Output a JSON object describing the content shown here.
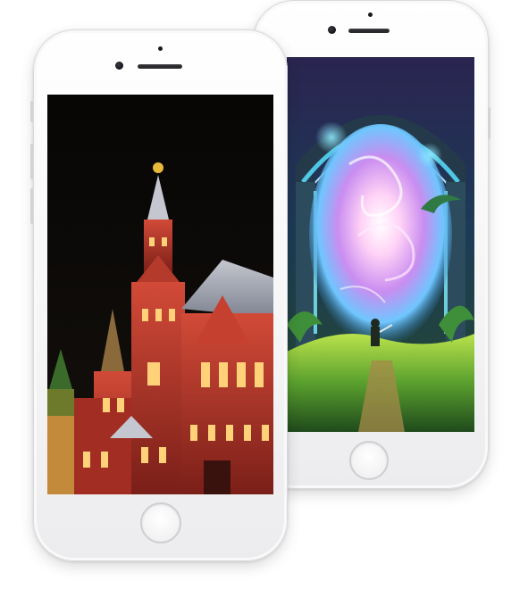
{
  "scene": {
    "phones": [
      {
        "name": "back-phone",
        "wallpaper": "fantasy-portal-artwork",
        "colors": {
          "glow": "#9fd8ff",
          "portal": "#f1b8f0",
          "grass": "#7fbf3a"
        }
      },
      {
        "name": "front-phone",
        "wallpaper": "moscow-state-historical-museum-night",
        "colors": {
          "brick": "#b8342a",
          "sky": "#0a0806",
          "lights": "#ffd27a"
        }
      }
    ]
  }
}
